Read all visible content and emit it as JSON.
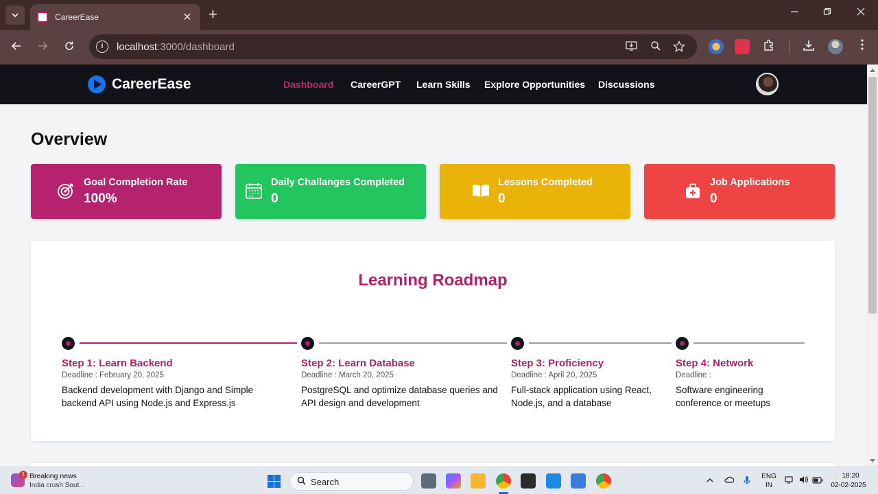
{
  "browser": {
    "tab_title": "CareerEase",
    "url_host": "localhost",
    "url_rest": ":3000/dashboard",
    "new_tab_label": "+",
    "close_tab_label": "✕"
  },
  "app": {
    "brand": "CareerEase",
    "nav": [
      "Dashboard",
      "CareerGPT",
      "Learn Skills",
      "Explore Opportunities",
      "Discussions"
    ],
    "active_nav": "Dashboard"
  },
  "overview": {
    "title": "Overview",
    "stats": [
      {
        "label": "Goal Completion Rate",
        "value": "100%",
        "color": "#b5226d",
        "icon": "target-icon"
      },
      {
        "label": "Daily Challanges Completed",
        "value": "0",
        "color": "#22c55e",
        "icon": "calendar-icon"
      },
      {
        "label": "Lessons Completed",
        "value": "0",
        "color": "#eab308",
        "icon": "book-icon"
      },
      {
        "label": "Job Applications",
        "value": "0",
        "color": "#ef4444",
        "icon": "briefcase-icon"
      }
    ]
  },
  "roadmap": {
    "title": "Learning Roadmap",
    "steps": [
      {
        "title": "Step 1: Learn Backend",
        "deadline": "Deadline : February 20, 2025",
        "desc": "Backend development with Django and Simple backend API using Node.js and Express.js",
        "completed": true
      },
      {
        "title": "Step 2: Learn Database",
        "deadline": "Deadline : March 20, 2025",
        "desc": "PostgreSQL and optimize database queries and API design and development",
        "completed": false
      },
      {
        "title": "Step 3: Proficiency",
        "deadline": "Deadline : April 20, 2025",
        "desc": "Full-stack application using React, Node.js, and a database",
        "completed": false
      },
      {
        "title": "Step 4: Network",
        "deadline": "Deadline :",
        "desc": "Software engineering conference or meetups",
        "completed": false
      }
    ]
  },
  "taskbar": {
    "news_title": "Breaking news",
    "news_sub": "India crush Sout...",
    "news_badge": "1",
    "search_label": "Search",
    "lang_top": "ENG",
    "lang_bottom": "IN",
    "time": "18:20",
    "date": "02-02-2025"
  },
  "colors": {
    "brand_accent": "#b0226a",
    "nav_bg": "#111318",
    "page_bg": "#f3f4f6"
  }
}
